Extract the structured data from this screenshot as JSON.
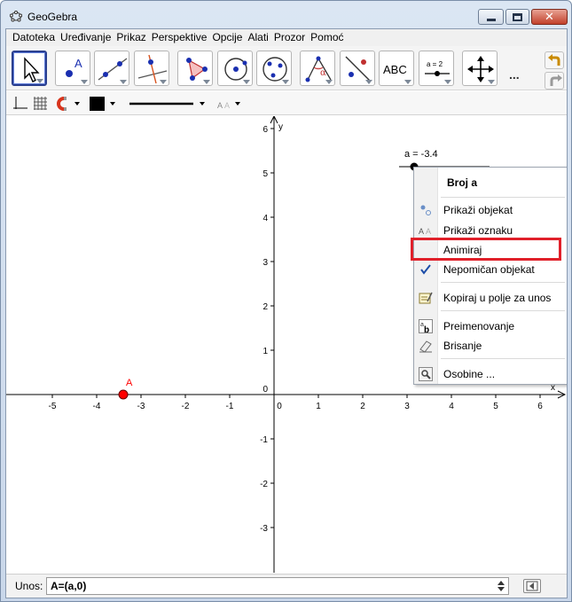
{
  "window": {
    "title": "GeoGebra"
  },
  "menu": [
    "Datoteka",
    "Uređivanje",
    "Prikaz",
    "Perspektive",
    "Opcije",
    "Alati",
    "Prozor",
    "Pomoć"
  ],
  "toolbar": {
    "tools": [
      "move-tool",
      "point-tool",
      "line-tool",
      "perpendicular-line-tool",
      "polygon-tool",
      "circle-tool",
      "conic-tool",
      "angle-tool",
      "reflect-tool",
      "text-tool",
      "slider-tool",
      "move-graphics-view-tool"
    ],
    "text_tool_label": "ABC",
    "slider_tool_label": "a = 2",
    "more_label": "..."
  },
  "graphics": {
    "y_axis_label": "y",
    "x_axis_label": "x",
    "x_ticks": [
      "-5",
      "-4",
      "-3",
      "-2",
      "-1",
      "0",
      "1",
      "2",
      "3",
      "4",
      "5",
      "6"
    ],
    "y_ticks": [
      "6",
      "5",
      "4",
      "3",
      "2",
      "1",
      "0",
      "-1",
      "-2",
      "-3"
    ],
    "point_label": "A",
    "point_color": "#ff0000",
    "slider_caption": "a = -3.4"
  },
  "context_menu": {
    "header": "Broj a",
    "items": {
      "show_object": "Prikaži objekat",
      "show_label": "Prikaži oznaku",
      "animate": "Animiraj",
      "fixed_object": "Nepomičan objekat",
      "copy_to_input": "Kopiraj u polje za unos",
      "rename": "Preimenovanje",
      "delete": "Brisanje",
      "properties": "Osobine ..."
    },
    "highlight_color": "#e0202a"
  },
  "input_bar": {
    "label": "Unos:",
    "value": "A=(a,0)"
  }
}
